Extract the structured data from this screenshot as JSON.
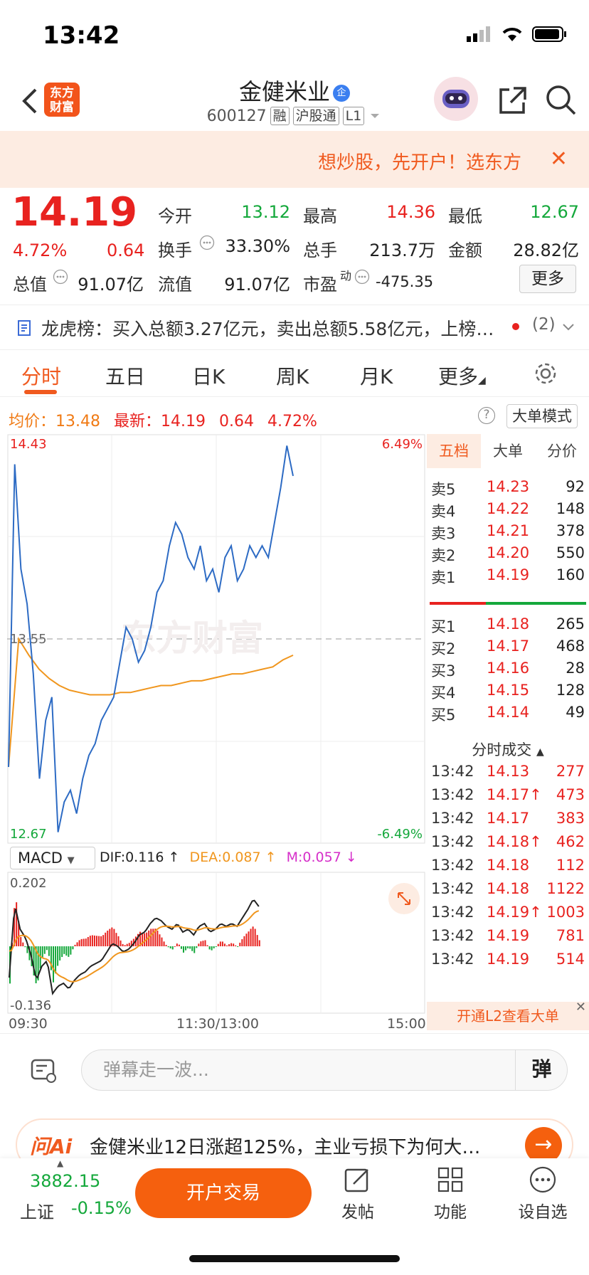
{
  "status": {
    "time": "13:42"
  },
  "header": {
    "logo": "东方\n财富",
    "name": "金健米业",
    "badge": "企",
    "code": "600127",
    "tags": [
      "融",
      "沪股通",
      "L1"
    ]
  },
  "promo": {
    "text": "想炒股，先开户！选东方"
  },
  "quote": {
    "price": "14.19",
    "pct": "4.72%",
    "change": "0.64",
    "labels": {
      "open": "今开",
      "high": "最高",
      "low": "最低",
      "turnover": "换手",
      "volume": "总手",
      "amount": "金额",
      "mktcap": "总值",
      "float": "流值",
      "pe": "市盈"
    },
    "values": {
      "open": "13.12",
      "high": "14.36",
      "low": "12.67",
      "turnover": "33.30%",
      "volume": "213.7万",
      "amount": "28.82亿",
      "mktcap": "91.07亿",
      "float": "91.07亿",
      "pe": "-475.35"
    },
    "pe_sup": "动",
    "more_label": "更多"
  },
  "lhb": {
    "text": "龙虎榜：买入总额3.27亿元，卖出总额5.58亿元，上榜…",
    "count": "(2)"
  },
  "tabs": [
    "分时",
    "五日",
    "日K",
    "周K",
    "月K",
    "更多"
  ],
  "avgrow": {
    "avg_label": "均价：",
    "avg": "13.48",
    "latest_label": "最新：",
    "latest": "14.19",
    "change": "0.64",
    "pct": "4.72%",
    "bigorder": "大单模式",
    "help": "?"
  },
  "chart_data": {
    "type": "line",
    "y_labels": {
      "top": "14.43",
      "mid": "13.55",
      "bottom": "12.67",
      "pct_top": "6.49%",
      "pct_bottom": "-6.49%"
    },
    "x_labels": [
      "09:30",
      "11:30/13:00",
      "15:00"
    ],
    "ylim": [
      12.67,
      14.43
    ],
    "series": [
      {
        "color": "#2d6bc4",
        "values": [
          13.0,
          14.3,
          13.85,
          13.7,
          13.4,
          12.95,
          13.2,
          13.3,
          12.72,
          12.85,
          12.9,
          12.8,
          12.95,
          13.05,
          13.1,
          13.2,
          13.25,
          13.3,
          13.45,
          13.6,
          13.55,
          13.45,
          13.5,
          13.6,
          13.75,
          13.8,
          13.95,
          14.05,
          14.0,
          13.9,
          13.85,
          13.95,
          13.8,
          13.85,
          13.75,
          13.9,
          13.95,
          13.8,
          13.85,
          13.95,
          13.9,
          13.95,
          13.9,
          14.05,
          14.2,
          14.38,
          14.25
        ]
      },
      {
        "color": "#f0961e",
        "values": [
          13.0,
          13.55,
          13.48,
          13.42,
          13.38,
          13.35,
          13.33,
          13.32,
          13.31,
          13.31,
          13.31,
          13.32,
          13.32,
          13.33,
          13.34,
          13.35,
          13.35,
          13.36,
          13.37,
          13.37,
          13.38,
          13.39,
          13.4,
          13.4,
          13.41,
          13.42,
          13.43,
          13.46,
          13.48
        ]
      }
    ],
    "macd": {
      "label": "MACD",
      "dif_label": "DIF:0.116",
      "dea_label": "DEA:0.087",
      "m_label": "M:0.057",
      "top": "0.202",
      "bottom": "-0.136"
    }
  },
  "orderbook": {
    "tabs": [
      "五档",
      "大单",
      "分价"
    ],
    "sells": [
      [
        "卖5",
        "14.23",
        "92"
      ],
      [
        "卖4",
        "14.22",
        "148"
      ],
      [
        "卖3",
        "14.21",
        "378"
      ],
      [
        "卖2",
        "14.20",
        "550"
      ],
      [
        "卖1",
        "14.19",
        "160"
      ]
    ],
    "buys": [
      [
        "买1",
        "14.18",
        "265"
      ],
      [
        "买2",
        "14.17",
        "468"
      ],
      [
        "买3",
        "14.16",
        "28"
      ],
      [
        "买4",
        "14.15",
        "128"
      ],
      [
        "买5",
        "14.14",
        "49"
      ]
    ],
    "ticks_head": "分时成交",
    "ticks": [
      [
        "13:42",
        "14.13",
        "277"
      ],
      [
        "13:42",
        "14.17↑",
        "473"
      ],
      [
        "13:42",
        "14.17",
        "383"
      ],
      [
        "13:42",
        "14.18↑",
        "462"
      ],
      [
        "13:42",
        "14.18",
        "112"
      ],
      [
        "13:42",
        "14.18",
        "1122"
      ],
      [
        "13:42",
        "14.19↑",
        "1003"
      ],
      [
        "13:42",
        "14.19",
        "781"
      ],
      [
        "13:42",
        "14.19",
        "514"
      ]
    ],
    "l2": "开通L2查看大单"
  },
  "comment": {
    "placeholder": "弹幕走一波...",
    "danmu": "弹"
  },
  "ai": {
    "logo": "问Ai",
    "text": "金健米业12日涨超125%，主业亏损下为何大…"
  },
  "bottom": {
    "index_value": "3882.15",
    "index_name": "上证",
    "index_pct": "-0.15%",
    "open_btn": "开户交易",
    "post": "发帖",
    "func": "功能",
    "watch": "设自选"
  }
}
